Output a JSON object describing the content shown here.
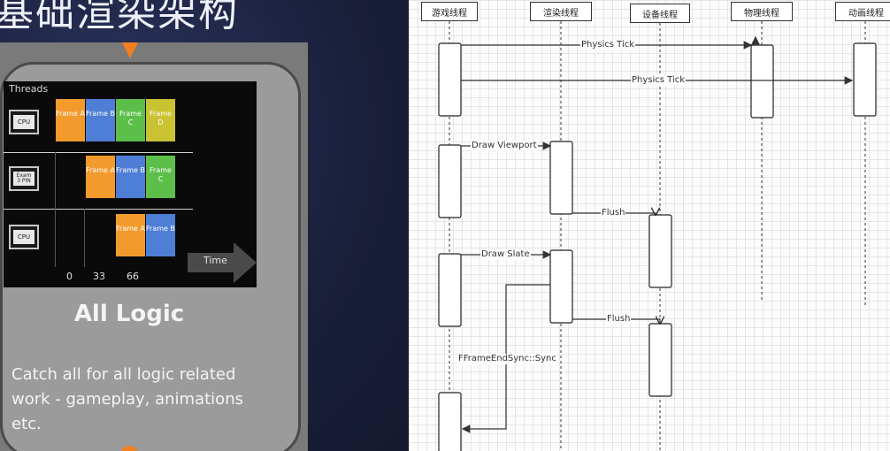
{
  "slide": {
    "title": "基础渲染架构",
    "card": {
      "heading": "All Logic",
      "description": "Catch all for all logic related work - gameplay, animations etc."
    },
    "threads_panel": {
      "label": "Threads",
      "chips": [
        "CPU",
        "Exam\n3 PIN",
        "CPU"
      ],
      "rows": [
        [
          "Frame A",
          "Frame B",
          "Frame C",
          "Frame D"
        ],
        [
          "Frame A",
          "Frame B",
          "Frame C"
        ],
        [
          "Frame A",
          "Frame B"
        ]
      ],
      "ticks": [
        "0",
        "33",
        "66"
      ],
      "time_label": "Time"
    },
    "accent_color": "#f08020"
  },
  "diagram": {
    "actors": [
      "游戏线程",
      "渲染线程",
      "设备线程",
      "物理线程",
      "动画线程"
    ],
    "messages": {
      "physics_tick_1": "Physics Tick",
      "physics_tick_2": "Physics Tick",
      "draw_viewport": "Draw Viewport",
      "flush_1": "Flush",
      "draw_slate": "Draw Slate",
      "flush_2": "Flush",
      "frame_end_sync": "FFrameEndSync::Sync"
    }
  }
}
